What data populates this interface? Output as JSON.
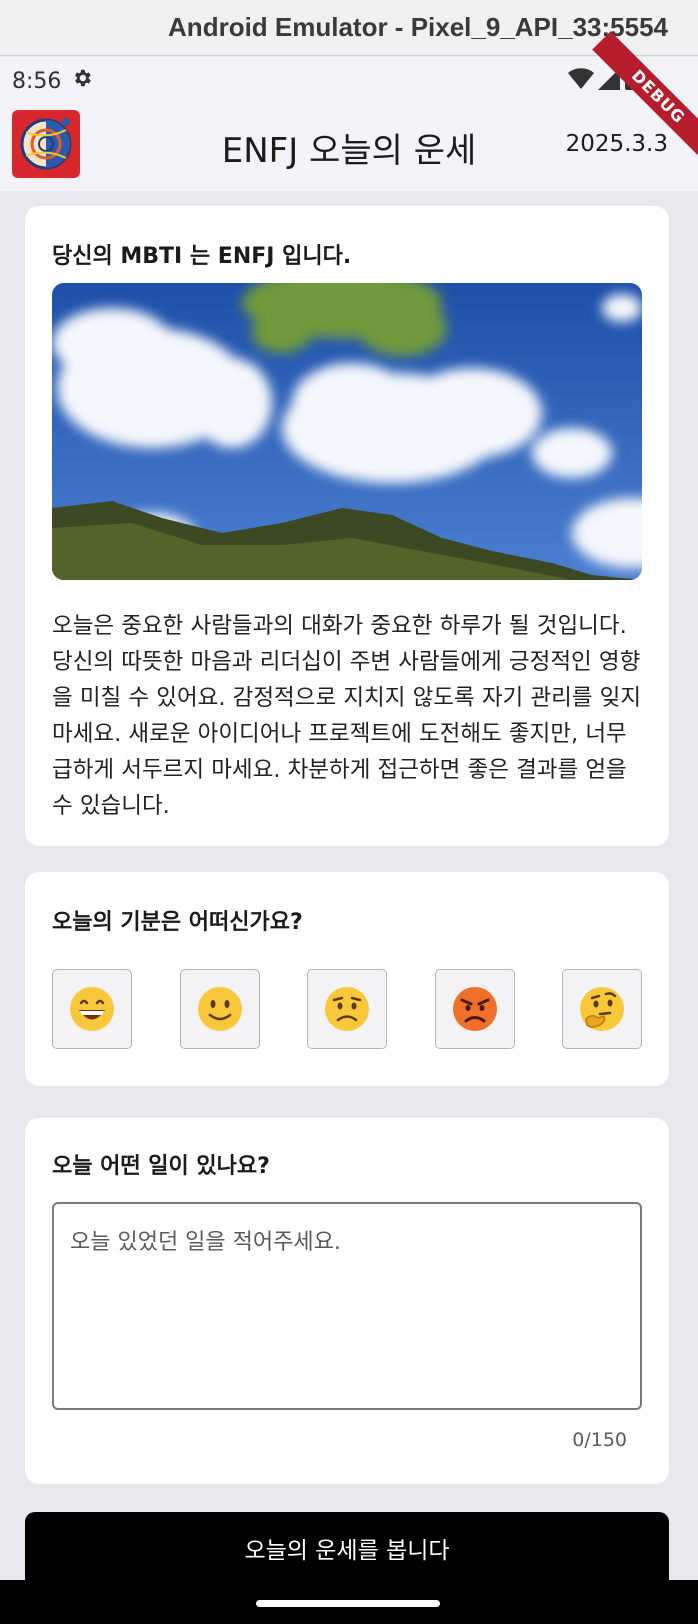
{
  "window": {
    "title": "Android Emulator - Pixel_9_API_33:5554"
  },
  "status_bar": {
    "time": "8:56",
    "icons": [
      "settings-gear-icon",
      "wifi-icon",
      "signal-icon",
      "battery-icon"
    ]
  },
  "debug_banner": "DEBUG",
  "app_bar": {
    "title": "ENFJ 오늘의 운세",
    "date": "2025.3.3"
  },
  "fortune_card": {
    "heading": "당신의 MBTI 는 ENFJ 입니다.",
    "body": "오늘은 중요한 사람들과의 대화가 중요한 하루가 될 것입니다. 당신의 따뜻한 마음과 리더십이 주변 사람들에게 긍정적인 영향을 미칠 수 있어요. 감정적으로 지치지 않도록 자기 관리를 잊지 마세요. 새로운 아이디어나 프로젝트에 도전해도 좋지만, 너무 급하게 서두르지 마세요. 차분하게 접근하면 좋은 결과를 얻을 수 있습니다."
  },
  "mood_card": {
    "heading": "오늘의 기분은 어떠신가요?",
    "options": [
      {
        "name": "grinning-face-icon",
        "emoji": "😄"
      },
      {
        "name": "slightly-smiling-face-icon",
        "emoji": "🙂"
      },
      {
        "name": "worried-face-icon",
        "emoji": "😟"
      },
      {
        "name": "angry-face-icon",
        "emoji": "😡"
      },
      {
        "name": "thinking-face-icon",
        "emoji": "🤔"
      }
    ]
  },
  "diary_card": {
    "heading": "오늘 어떤 일이 있나요?",
    "placeholder": "오늘 있었던 일을 적어주세요.",
    "value": "",
    "counter": "0/150"
  },
  "cta": {
    "label": "오늘의 운세를 봅니다"
  },
  "colors": {
    "app_background": "#e8e8ec",
    "card": "#ffffff",
    "cta_background": "#000000",
    "debug_ribbon": "#b71c2c",
    "logo_background": "#d8282e"
  }
}
